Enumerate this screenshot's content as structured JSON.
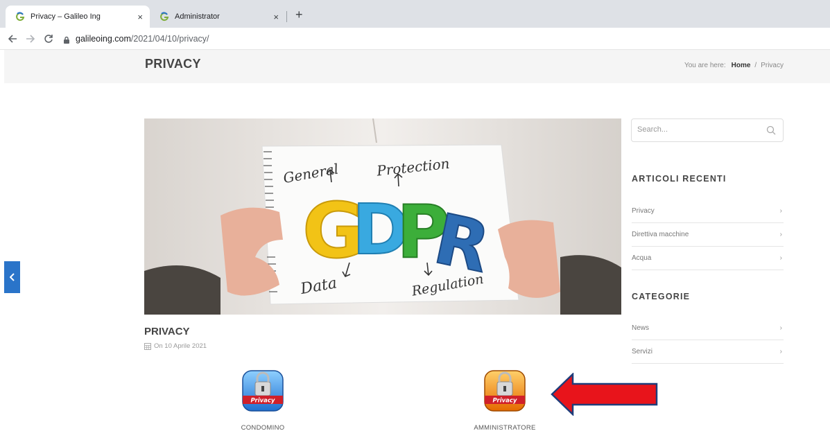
{
  "browser": {
    "tabs": [
      {
        "title": "Privacy – Galileo Ing",
        "active": true
      },
      {
        "title": "Administrator",
        "active": false
      }
    ],
    "close_glyph": "×",
    "new_tab_glyph": "+",
    "url_host": "galileoing.com",
    "url_path": "/2021/04/10/privacy/"
  },
  "header": {
    "title": "PRIVACY",
    "breadcrumb_prefix": "You are here:",
    "breadcrumb_home": "Home",
    "breadcrumb_sep": "/",
    "breadcrumb_current": "Privacy"
  },
  "hero": {
    "letters": [
      "G",
      "D",
      "P",
      "R"
    ],
    "words": {
      "general": "General",
      "protection": "Protection",
      "data": "Data",
      "regulation": "Regulation"
    }
  },
  "post": {
    "title": "PRIVACY",
    "date": "On 10 Aprile 2021",
    "icons": [
      {
        "badge": "Privacy",
        "label": "CONDOMINO",
        "color": "blue"
      },
      {
        "badge": "Privacy",
        "label": "AMMINISTRATORE",
        "color": "orange"
      }
    ]
  },
  "sidebar": {
    "search_placeholder": "Search...",
    "recent_title": "ARTICOLI RECENTI",
    "recent": [
      "Privacy",
      "Direttiva macchine",
      "Acqua"
    ],
    "categories_title": "CATEGORIE",
    "categories": [
      "News",
      "Servizi"
    ]
  },
  "colors": {
    "accent": "#2a74c9",
    "arrow": "#e8141b",
    "arrow_border": "#1f3d7a"
  }
}
